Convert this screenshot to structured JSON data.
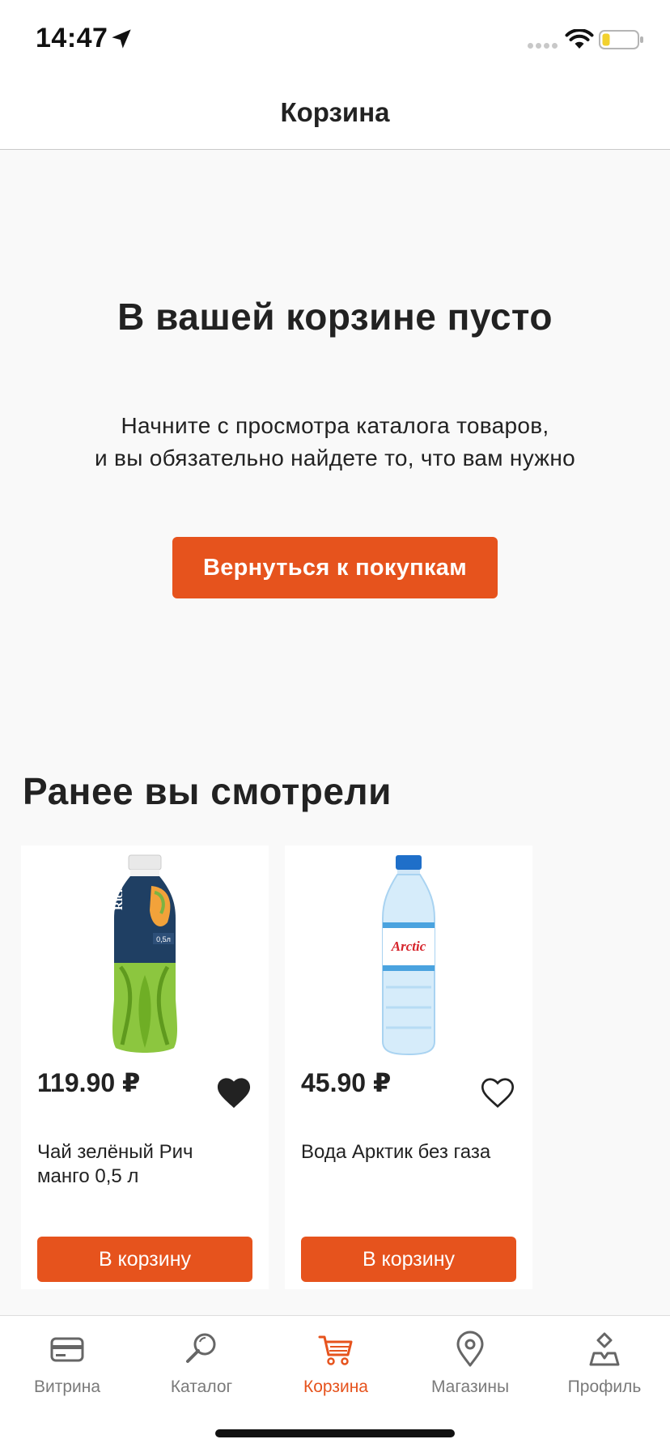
{
  "status_bar": {
    "time": "14:47"
  },
  "header": {
    "title": "Корзина"
  },
  "empty_cart": {
    "title": "В вашей корзине пусто",
    "text_line1": "Начните с просмотра каталога товаров,",
    "text_line2": "и вы обязательно найдете то, что вам нужно",
    "button_label": "Вернуться к покупкам"
  },
  "recent": {
    "title": "Ранее вы смотрели",
    "products": [
      {
        "price": "119.90 ₽",
        "name": "Чай зелёный Рич манго 0,5 л",
        "favorite": true,
        "button_label": "В корзину",
        "image_icon": "green-tea-bottle-image"
      },
      {
        "price": "45.90 ₽",
        "name": "Вода Арктик без газа",
        "favorite": false,
        "button_label": "В корзину",
        "image_icon": "water-bottle-image"
      }
    ]
  },
  "tab_bar": {
    "items": [
      {
        "label": "Витрина",
        "icon": "card-icon",
        "active": false
      },
      {
        "label": "Каталог",
        "icon": "magnifier-icon",
        "active": false
      },
      {
        "label": "Корзина",
        "icon": "cart-icon",
        "active": true
      },
      {
        "label": "Магазины",
        "icon": "map-pin-icon",
        "active": false
      },
      {
        "label": "Профиль",
        "icon": "profile-icon",
        "active": false
      }
    ]
  },
  "colors": {
    "accent": "#e6531d",
    "background": "#f9f9f9",
    "text": "#222222",
    "tab_inactive": "#7a7a7a"
  }
}
